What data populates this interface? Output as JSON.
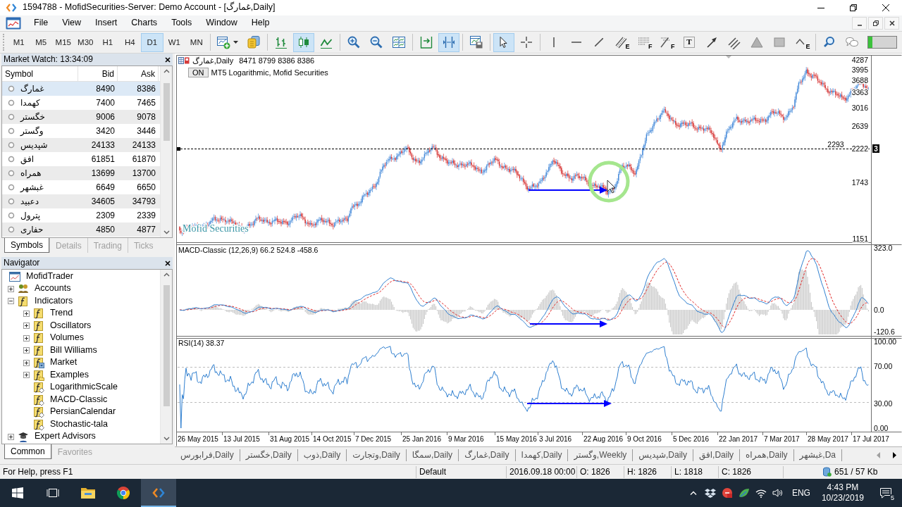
{
  "window": {
    "title": "1594788 - MofidSecurities-Server: Demo Account - [غمارگ,Daily]"
  },
  "menu": [
    "File",
    "View",
    "Insert",
    "Charts",
    "Tools",
    "Window",
    "Help"
  ],
  "toolbar": {
    "timeframes": [
      {
        "label": "M1",
        "selected": false
      },
      {
        "label": "M5",
        "selected": false
      },
      {
        "label": "M15",
        "selected": false
      },
      {
        "label": "M30",
        "selected": false
      },
      {
        "label": "H1",
        "selected": false
      },
      {
        "label": "H4",
        "selected": false
      },
      {
        "label": "D1",
        "selected": true
      },
      {
        "label": "W1",
        "selected": false
      },
      {
        "label": "MN",
        "selected": false
      }
    ],
    "tool_groups": [
      [
        {
          "selected": false
        },
        {
          "selected": false
        }
      ],
      [
        {
          "selected": false
        },
        {
          "selected": true
        },
        {
          "selected": false
        }
      ],
      [
        {
          "selected": false
        },
        {
          "selected": false
        },
        {
          "selected": false
        }
      ],
      [
        {
          "selected": false
        },
        {
          "selected": true
        }
      ],
      [
        {
          "selected": false
        }
      ],
      [
        {
          "selected": true
        },
        {
          "selected": false
        }
      ],
      [
        {
          "selected": false
        },
        {
          "selected": false
        },
        {
          "selected": false
        },
        {
          "selected": false,
          "letter": "E"
        },
        {
          "selected": false,
          "letter": "F"
        },
        {
          "selected": false,
          "letter": "F"
        },
        {
          "selected": false,
          "letter": "T"
        },
        {
          "selected": false
        },
        {
          "selected": false
        },
        {
          "selected": false
        },
        {
          "selected": false
        },
        {
          "selected": false,
          "letter": "E"
        }
      ],
      [
        {
          "selected": false
        },
        {
          "selected": false
        }
      ]
    ],
    "connection": {
      "level": 0.15
    }
  },
  "market_watch": {
    "title": "Market Watch: 13:34:09",
    "columns": [
      "Symbol",
      "Bid",
      "Ask"
    ],
    "rows": [
      {
        "symbol": "غمارگ",
        "bid": "8490",
        "ask": "8386",
        "selected": true
      },
      {
        "symbol": "کهمدا",
        "bid": "7400",
        "ask": "7465",
        "selected": false
      },
      {
        "symbol": "خگستر",
        "bid": "9006",
        "ask": "9078",
        "selected": false
      },
      {
        "symbol": "وگستر",
        "bid": "3420",
        "ask": "3446",
        "selected": false
      },
      {
        "symbol": "شپدیس",
        "bid": "24133",
        "ask": "24133",
        "selected": false
      },
      {
        "symbol": "افق",
        "bid": "61851",
        "ask": "61870",
        "selected": false
      },
      {
        "symbol": "همراه",
        "bid": "13699",
        "ask": "13700",
        "selected": false
      },
      {
        "symbol": "غبشهر",
        "bid": "6649",
        "ask": "6650",
        "selected": false
      },
      {
        "symbol": "دعبید",
        "bid": "34605",
        "ask": "34793",
        "selected": false
      },
      {
        "symbol": "پترول",
        "bid": "2309",
        "ask": "2339",
        "selected": false
      },
      {
        "symbol": "حفاری",
        "bid": "4850",
        "ask": "4877",
        "selected": false
      }
    ],
    "tabs": [
      {
        "label": "Symbols",
        "selected": true
      },
      {
        "label": "Details",
        "selected": false
      },
      {
        "label": "Trading",
        "selected": false
      },
      {
        "label": "Ticks",
        "selected": false
      }
    ]
  },
  "navigator": {
    "title": "Navigator",
    "tree": [
      {
        "label": "MofidTrader",
        "kind": "terminal",
        "children": [
          {
            "label": "Accounts",
            "kind": "accounts",
            "expanded": false
          },
          {
            "label": "Indicators",
            "kind": "folder",
            "expanded": true,
            "children": [
              {
                "label": "Trend",
                "kind": "folder",
                "expanded": false
              },
              {
                "label": "Oscillators",
                "kind": "folder",
                "expanded": false
              },
              {
                "label": "Volumes",
                "kind": "folder",
                "expanded": false
              },
              {
                "label": "Bill Williams",
                "kind": "folder",
                "expanded": false
              },
              {
                "label": "Market",
                "kind": "market",
                "expanded": false
              },
              {
                "label": "Examples",
                "kind": "examples",
                "expanded": false
              },
              {
                "label": "LogarithmicScale",
                "kind": "indicator"
              },
              {
                "label": "MACD-Classic",
                "kind": "indicator"
              },
              {
                "label": "PersianCalendar",
                "kind": "indicator"
              },
              {
                "label": "Stochastic-tala",
                "kind": "indicator"
              }
            ]
          },
          {
            "label": "Expert Advisors",
            "kind": "experts",
            "expanded": false
          }
        ]
      }
    ],
    "tabs": [
      {
        "label": "Common",
        "selected": true
      },
      {
        "label": "Favorites",
        "selected": false
      }
    ]
  },
  "chart": {
    "title": "غمارگ,Daily",
    "quotes": "8471 8799 8386 8386",
    "button": "ON",
    "note": "MT5 Logarithmic, Mofid Securities",
    "caption": "Mofid Securities",
    "price_labels": [
      "4287",
      "3995",
      "3688",
      "3363",
      "3016",
      "2639",
      "2222",
      "1743",
      "1151"
    ],
    "level_label": "2293",
    "price_tag": "3",
    "macd_label": "MACD-Classic (12,26,9) 66.2 524.8 -458.6",
    "macd_labels": [
      "323.0",
      "0.0",
      "-120.6"
    ],
    "rsi_label": "RSI(14) 38.37",
    "rsi_labels": [
      "100.00",
      "70.00",
      "30.00",
      "0.00"
    ],
    "dates": [
      "26 May 2015",
      "13 Jul 2015",
      "31 Aug 2015",
      "14 Oct 2015",
      "7 Dec 2015",
      "25 Jan 2016",
      "9 Mar 2016",
      "15 May 2016",
      "3 Jul 2016",
      "22 Aug 2016",
      "9 Oct 2016",
      "5 Dec 2016",
      "22 Jan 2017",
      "7 Mar 2017",
      "28 May 2017",
      "17 Jul 2017"
    ]
  },
  "chart_tabs": [
    {
      "label": "فرابورس,Daily",
      "selected": false
    },
    {
      "label": "خگستر,Daily",
      "selected": false
    },
    {
      "label": "ذوب,Daily",
      "selected": false
    },
    {
      "label": "وتجارت,Daily",
      "selected": false
    },
    {
      "label": "سمگا,Daily",
      "selected": false
    },
    {
      "label": "غمارگ,Daily",
      "selected": false
    },
    {
      "label": "کهمدا,Daily",
      "selected": false
    },
    {
      "label": "وگستر,Weekly",
      "selected": false
    },
    {
      "label": "شپدیس,Daily",
      "selected": false
    },
    {
      "label": "افق,Daily",
      "selected": false
    },
    {
      "label": "همراه,Daily",
      "selected": false
    },
    {
      "label": "غبشهر,Da",
      "selected": false
    }
  ],
  "status_bar": {
    "help": "For Help, press F1",
    "profile": "Default",
    "datetime": "2016.09.18 00:00",
    "open": "O: 1826",
    "high": "H: 1826",
    "low": "L: 1818",
    "close": "C: 1826",
    "traffic": "651 / 57 Kb"
  },
  "taskbar": {
    "apps": [
      {
        "active": false
      },
      {
        "active": false
      },
      {
        "active": true
      }
    ],
    "language": "ENG",
    "time": "4:43 PM",
    "date": "10/23/2019",
    "notification_count": "5"
  }
}
